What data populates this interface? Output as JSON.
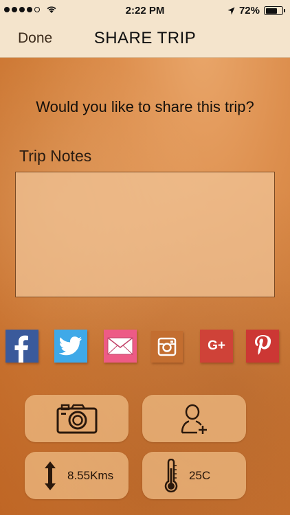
{
  "status_bar": {
    "time": "2:22 PM",
    "battery": "72%",
    "battery_level": 0.72,
    "signal_bars": 4
  },
  "nav": {
    "done_label": "Done",
    "title": "SHARE TRIP"
  },
  "content": {
    "question": "Would you like to share this trip?",
    "notes_label": "Trip Notes",
    "notes_value": ""
  },
  "share": [
    {
      "name": "facebook-icon",
      "text": "f"
    },
    {
      "name": "twitter-icon",
      "text": ""
    },
    {
      "name": "email-icon",
      "text": ""
    },
    {
      "name": "instagram-icon",
      "text": ""
    },
    {
      "name": "google-plus-icon",
      "text": "G+"
    },
    {
      "name": "pinterest-icon",
      "text": "P"
    }
  ],
  "stats": {
    "distance": "8.55Kms",
    "temperature": "25C"
  },
  "colors": {
    "facebook": "#3a5a9b",
    "twitter": "#3fa9e8",
    "email": "#ed5b86",
    "instagram": "#c36e30",
    "google_plus": "#cf4238",
    "pinterest": "#cc3734",
    "bar": "#f4e4cc"
  }
}
